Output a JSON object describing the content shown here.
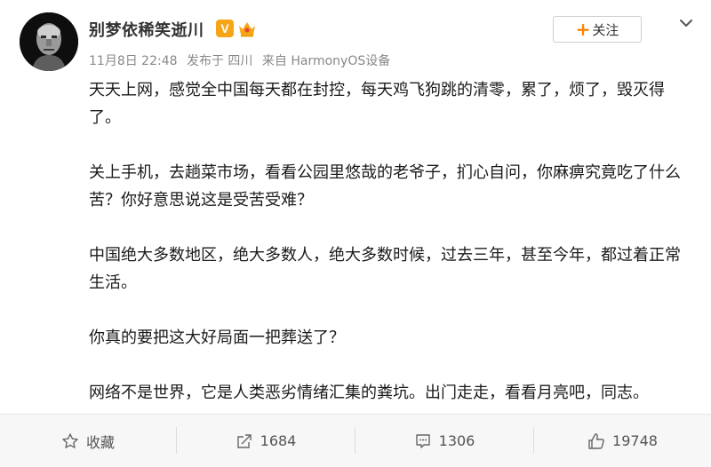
{
  "post": {
    "username": "别梦依稀笑逝川",
    "verified_badge": "V",
    "meta": {
      "date": "11月8日 22:48",
      "location": "发布于 四川",
      "source": "来自 HarmonyOS设备"
    },
    "follow_label": "关注",
    "paragraphs": [
      "天天上网，感觉全中国每天都在封控，每天鸡飞狗跳的清零，累了，烦了，毁灭得了。",
      "关上手机，去趟菜市场，看看公园里悠哉的老爷子，扪心自问，你麻痹究竟吃了什么苦？你好意思说这是受苦受难？",
      "中国绝大多数地区，绝大多数人，绝大多数时候，过去三年，甚至今年，都过着正常生活。",
      "你真的要把这大好局面一把葬送了？",
      "网络不是世界，它是人类恶劣情绪汇集的粪坑。出门走走，看看月亮吧，同志。"
    ]
  },
  "actions": {
    "favorite_label": "收藏",
    "repost_count": "1684",
    "comment_count": "1306",
    "like_count": "19748"
  },
  "colors": {
    "accent": "#ff8200",
    "badge": "#f6a516",
    "meta_text": "#888888",
    "action_bg": "#f7f7f7"
  },
  "icons": [
    "avatar",
    "verified-v-icon",
    "crown-badge-icon",
    "chevron-down-icon",
    "star-icon",
    "repost-icon",
    "comment-icon",
    "thumbs-up-icon"
  ]
}
